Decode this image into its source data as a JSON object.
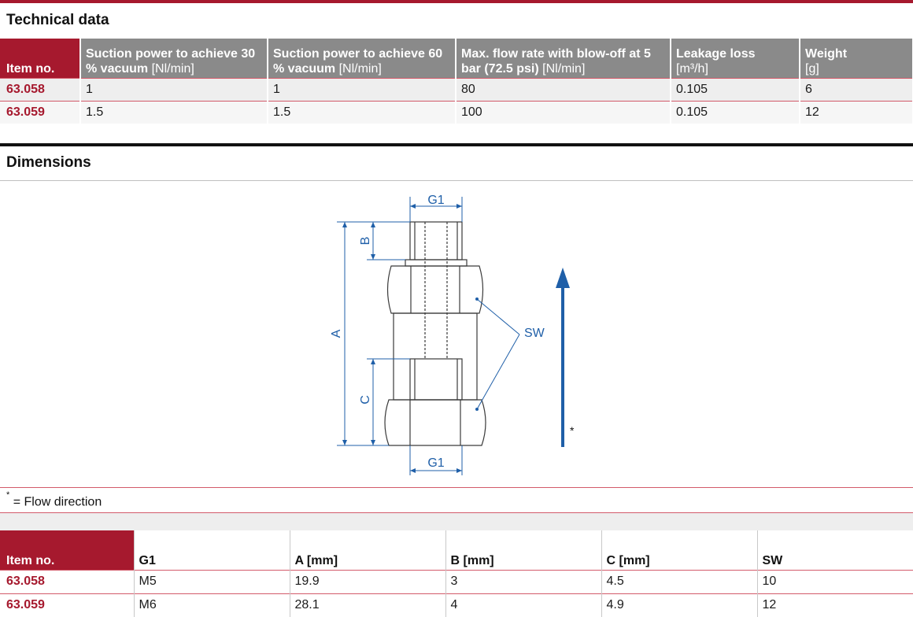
{
  "technical_data": {
    "title": "Technical data",
    "headers": [
      {
        "key": "Item no.",
        "unit": ""
      },
      {
        "key": "Suction power to achieve 30 % vacuum",
        "unit": "[Nl/min]"
      },
      {
        "key": "Suction power to achieve 60 % vacuum",
        "unit": "[Nl/min]"
      },
      {
        "key": "Max. flow rate with blow-off at 5 bar (72.5 psi)",
        "unit": "[Nl/min]"
      },
      {
        "key": "Leakage loss",
        "unit": "[m³/h]"
      },
      {
        "key": "Weight",
        "unit": "[g]"
      }
    ],
    "rows": [
      [
        "63.058",
        "1",
        "1",
        "80",
        "0.105",
        "6"
      ],
      [
        "63.059",
        "1.5",
        "1.5",
        "100",
        "0.105",
        "12"
      ]
    ]
  },
  "dimensions": {
    "title": "Dimensions",
    "drawing_labels": {
      "g1_top": "G1",
      "g1_bottom": "G1",
      "a": "A",
      "b": "B",
      "c": "C",
      "sw": "SW",
      "flow_marker": "*"
    },
    "footnote": {
      "marker": "*",
      "text": "= Flow direction"
    },
    "headers": [
      {
        "key": "Item no.",
        "unit": ""
      },
      {
        "key": "G1",
        "unit": ""
      },
      {
        "key": "A",
        "unit": "[mm]"
      },
      {
        "key": "B",
        "unit": "[mm]"
      },
      {
        "key": "C",
        "unit": "[mm]"
      },
      {
        "key": "SW",
        "unit": ""
      }
    ],
    "rows": [
      [
        "63.058",
        "M5",
        "19.9",
        "3",
        "4.5",
        "10"
      ],
      [
        "63.059",
        "M6",
        "28.1",
        "4",
        "4.9",
        "12"
      ]
    ]
  },
  "colors": {
    "brand_red": "#a6192e",
    "header_gray": "#8a8a8a",
    "drawing_blue": "#1f5fa8"
  }
}
